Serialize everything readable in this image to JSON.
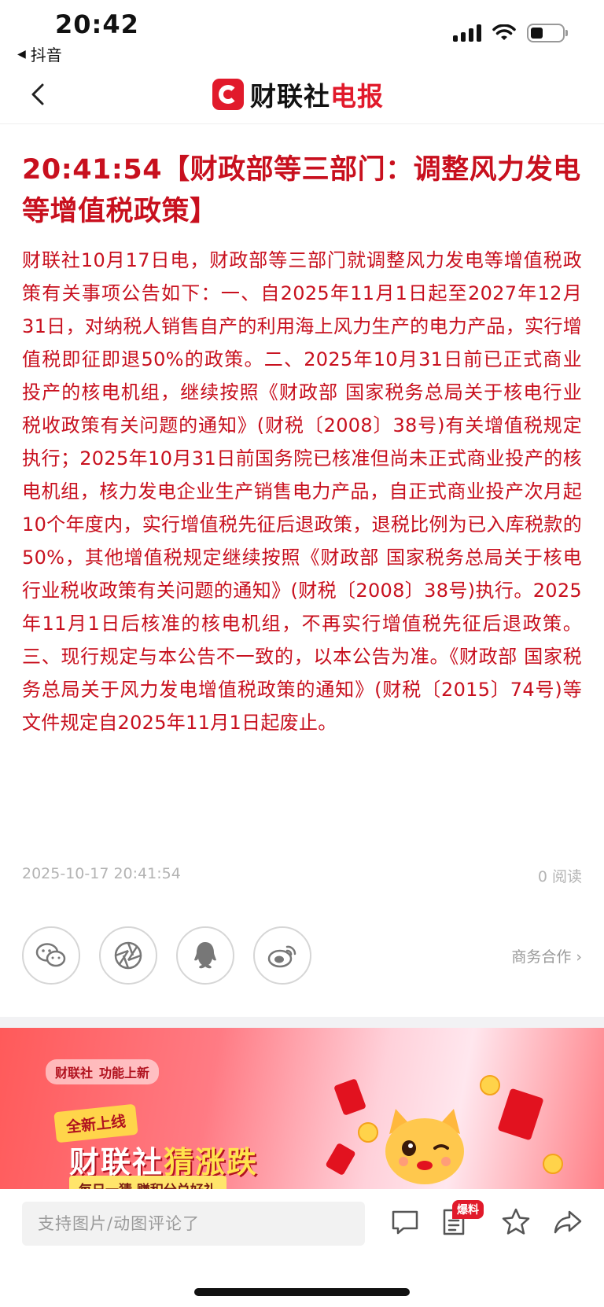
{
  "status_bar": {
    "time": "20:42",
    "back_app": "抖音"
  },
  "header": {
    "logo_prefix": "财联社",
    "logo_suffix": "电报"
  },
  "article": {
    "headline": "20:41:54【财政部等三部门：调整风力发电等增值税政策】",
    "body": "财联社10月17日电，财政部等三部门就调整风力发电等增值税政策有关事项公告如下：一、自2025年11月1日起至2027年12月31日，对纳税人销售自产的利用海上风力生产的电力产品，实行增值税即征即退50%的政策。二、2025年10月31日前已正式商业投产的核电机组，继续按照《财政部 国家税务总局关于核电行业税收政策有关问题的通知》(财税〔2008〕38号)有关增值税规定执行；2025年10月31日前国务院已核准但尚未正式商业投产的核电机组，核力发电企业生产销售电力产品，自正式商业投产次月起10个年度内，实行增值税先征后退政策，退税比例为已入库税款的50%，其他增值税规定继续按照《财政部 国家税务总局关于核电行业税收政策有关问题的通知》(财税〔2008〕38号)执行。2025年11月1日后核准的核电机组，不再实行增值税先征后退政策。三、现行规定与本公告不一致的，以本公告为准。《财政部 国家税务总局关于风力发电增值税政策的通知》(财税〔2015〕74号)等文件规定自2025年11月1日起废止。",
    "timestamp": "2025-10-17 20:41:54",
    "read_count": "0 阅读"
  },
  "share": {
    "partner_label": "商务合作 ›"
  },
  "banner": {
    "tag_brand": "财联社",
    "tag_text": "功能上新",
    "new_label": "全新上线",
    "title_prefix": "财联社",
    "title_highlight": "猜涨跌",
    "subtitle": "每日一猜 赚积分兑好礼"
  },
  "bottom_bar": {
    "comment_placeholder": "支持图片/动图评论了",
    "hot_badge": "爆料"
  }
}
